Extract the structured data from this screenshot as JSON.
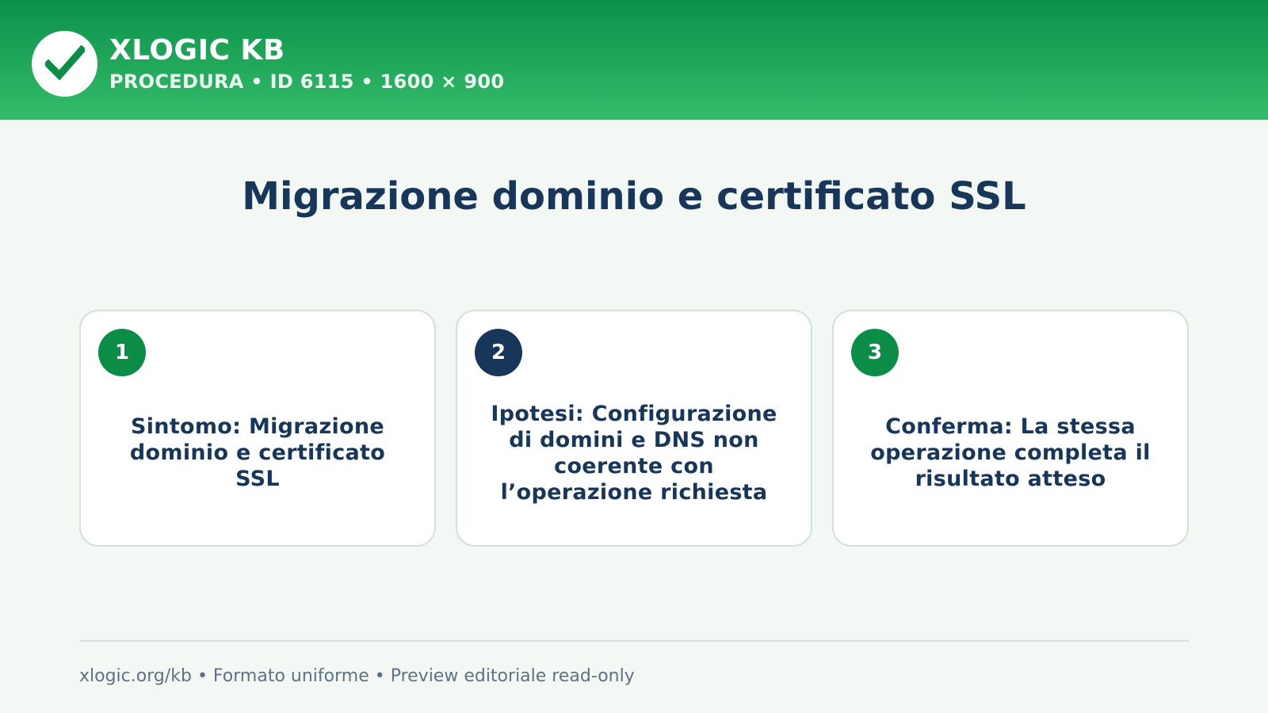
{
  "header": {
    "brand": "XLOGIC KB",
    "subline": "PROCEDURA • ID 6115 • 1600 × 900",
    "logo_icon": "check-icon",
    "colors": {
      "gradient_top": "#0b914a",
      "gradient_bottom": "#34bb6a",
      "check": "#0b8d48"
    }
  },
  "main": {
    "title": "Migrazione dominio e certificato SSL",
    "steps": [
      {
        "number": "1",
        "text": "Sintomo: Migrazione dominio e certificato SSL",
        "badge_color": "#0b8d48"
      },
      {
        "number": "2",
        "text": "Ipotesi: Configurazione di domini e DNS non coerente con l’operazione richiesta",
        "badge_color": "#17365a"
      },
      {
        "number": "3",
        "text": "Conferma: La stessa operazione completa il risultato atteso",
        "badge_color": "#0b8d48"
      }
    ]
  },
  "footer": {
    "text": "xlogic.org/kb • Formato uniforme • Preview editoriale read-only"
  }
}
